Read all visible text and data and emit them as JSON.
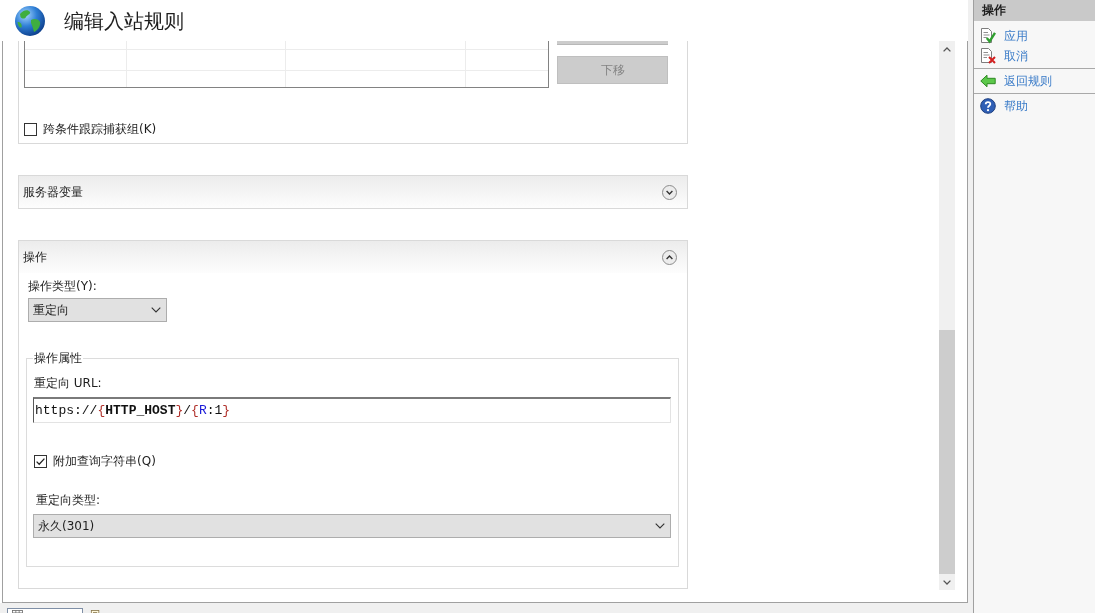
{
  "window": {
    "title": "编辑入站规则"
  },
  "conditions_section": {
    "move_down_button": {
      "label": "下移",
      "disabled": true
    },
    "track_capture_groups": {
      "label": "跨条件跟踪捕获组(K)",
      "checked": false
    }
  },
  "server_variables_section": {
    "title": "服务器变量",
    "expanded": false
  },
  "action_section": {
    "title": "操作",
    "expanded": true,
    "action_type": {
      "label": "操作类型(Y):",
      "value": "重定向"
    },
    "properties": {
      "title": "操作属性",
      "redirect_url": {
        "label": "重定向 URL:",
        "value_tokens": [
          {
            "text": "https://",
            "kind": "plain"
          },
          {
            "text": "{",
            "kind": "brace"
          },
          {
            "text": "HTTP_HOST",
            "kind": "server_variable"
          },
          {
            "text": "}",
            "kind": "brace"
          },
          {
            "text": "/",
            "kind": "plain"
          },
          {
            "text": "{",
            "kind": "brace"
          },
          {
            "text": "R",
            "kind": "back_reference"
          },
          {
            "text": ":1",
            "kind": "plain"
          },
          {
            "text": "}",
            "kind": "brace"
          }
        ]
      },
      "append_query_string": {
        "label": "附加查询字符串(Q)",
        "checked": true
      },
      "redirect_type": {
        "label": "重定向类型:",
        "value": "永久(301)"
      }
    }
  },
  "actions_panel": {
    "title": "操作",
    "groups": [
      {
        "items": [
          {
            "label": "应用",
            "kind": "apply"
          },
          {
            "label": "取消",
            "kind": "cancel"
          }
        ]
      },
      {
        "items": [
          {
            "label": "返回规则",
            "kind": "back"
          }
        ]
      },
      {
        "items": [
          {
            "label": "帮助",
            "kind": "help"
          }
        ]
      }
    ]
  },
  "view_tabs": [
    {
      "kind": "grid",
      "selected": true
    },
    {
      "kind": "page",
      "selected": false
    }
  ]
}
